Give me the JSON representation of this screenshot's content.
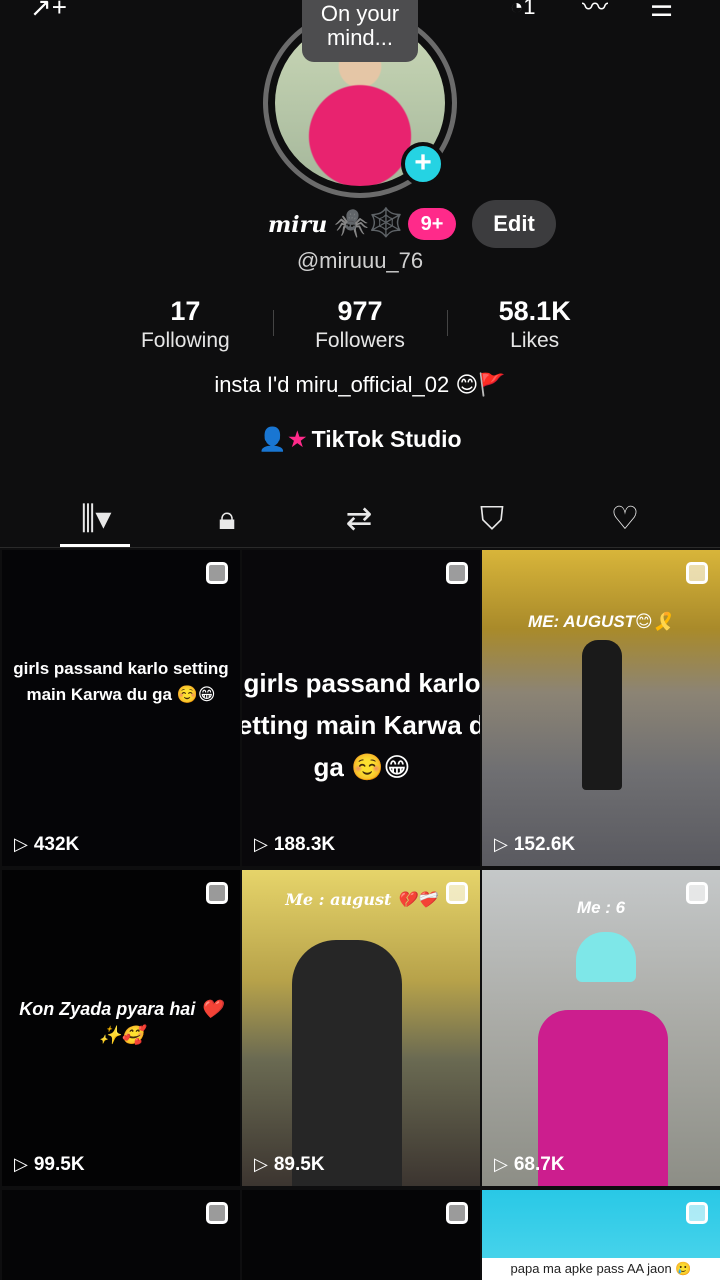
{
  "topbar": {
    "add_icon": "add-user-icon",
    "menu_icon": "menu-icon",
    "notif_count": "1"
  },
  "avatar": {
    "mind_bubble": "On your mind..."
  },
  "profile": {
    "display_name": "miru",
    "display_name_emoji": "🕷️🕸️",
    "badge": "9+",
    "edit_label": "Edit",
    "username": "@miruuu_76",
    "bio": "insta I'd miru_official_02 😊🚩",
    "studio_label": "TikTok Studio"
  },
  "stats": [
    {
      "value": "17",
      "label": "Following"
    },
    {
      "value": "977",
      "label": "Followers"
    },
    {
      "value": "58.1K",
      "label": "Likes"
    }
  ],
  "tabs": [
    "videos-tab",
    "private-tab",
    "reposts-tab",
    "favorites-tab",
    "liked-tab"
  ],
  "videos": [
    {
      "views": "432K",
      "caption": "girls passand karlo setting main Karwa du ga ☺️😁"
    },
    {
      "views": "188.3K",
      "caption": "girls passand karlo setting main Karwa du ga ☺️😁"
    },
    {
      "views": "152.6K",
      "caption": "ME: AUGUST😊🎗️"
    },
    {
      "views": "99.5K",
      "caption": "Kon Zyada pyara hai ❤️✨🥰"
    },
    {
      "views": "89.5K",
      "caption": "Me : august 💔❤️‍🩹"
    },
    {
      "views": "68.7K",
      "caption": "Me : 6"
    },
    {
      "views": "",
      "caption": ""
    },
    {
      "views": "",
      "caption": ""
    },
    {
      "views": "",
      "caption": "papa ma apke pass AA jaon 🥲"
    }
  ],
  "colors": {
    "accent_pink": "#ff2a8a",
    "accent_cyan": "#25d3e3",
    "background": "#0e0e0f"
  }
}
